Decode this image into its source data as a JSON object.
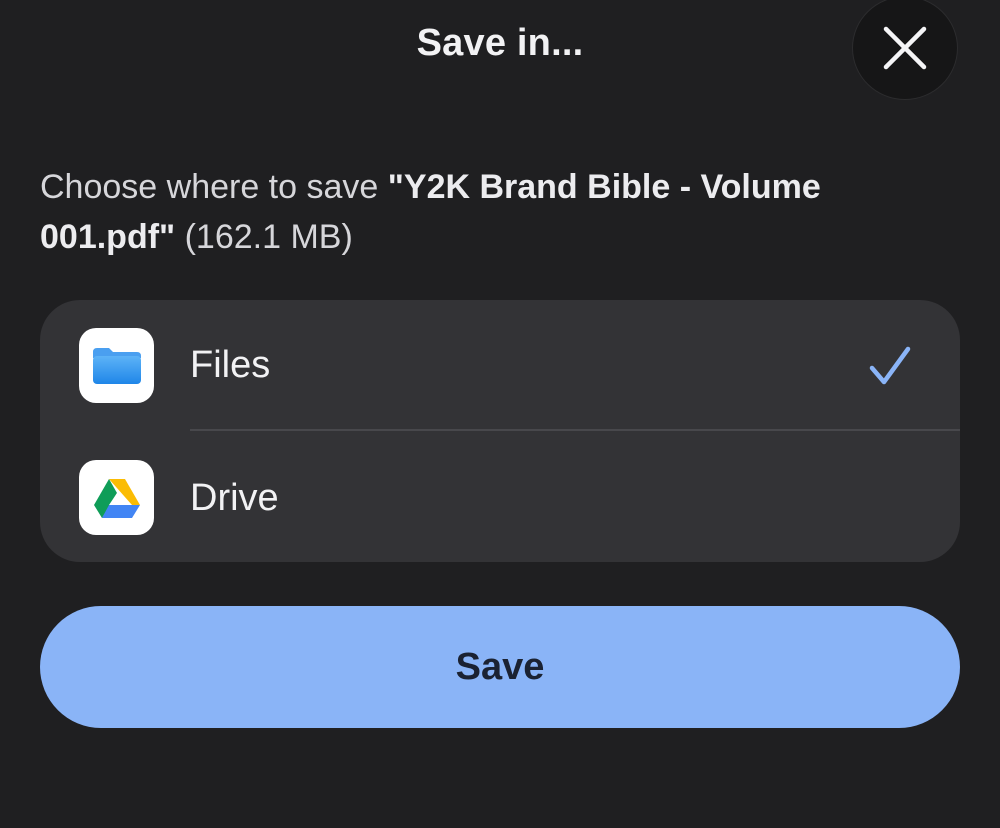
{
  "dialog": {
    "title": "Save in...",
    "description_prefix": "Choose where to save ",
    "file_name": "\"Y2K Brand Bible - Volume 001.pdf\"",
    "file_size": " (162.1 MB)"
  },
  "options": [
    {
      "label": "Files",
      "icon": "files-folder-icon",
      "selected": true
    },
    {
      "label": "Drive",
      "icon": "google-drive-icon",
      "selected": false
    }
  ],
  "actions": {
    "save_label": "Save",
    "close_icon": "close-icon"
  },
  "colors": {
    "background": "#1f1f21",
    "card": "#333336",
    "accent": "#8ab4f7",
    "checkmark": "#8ab4f7"
  }
}
